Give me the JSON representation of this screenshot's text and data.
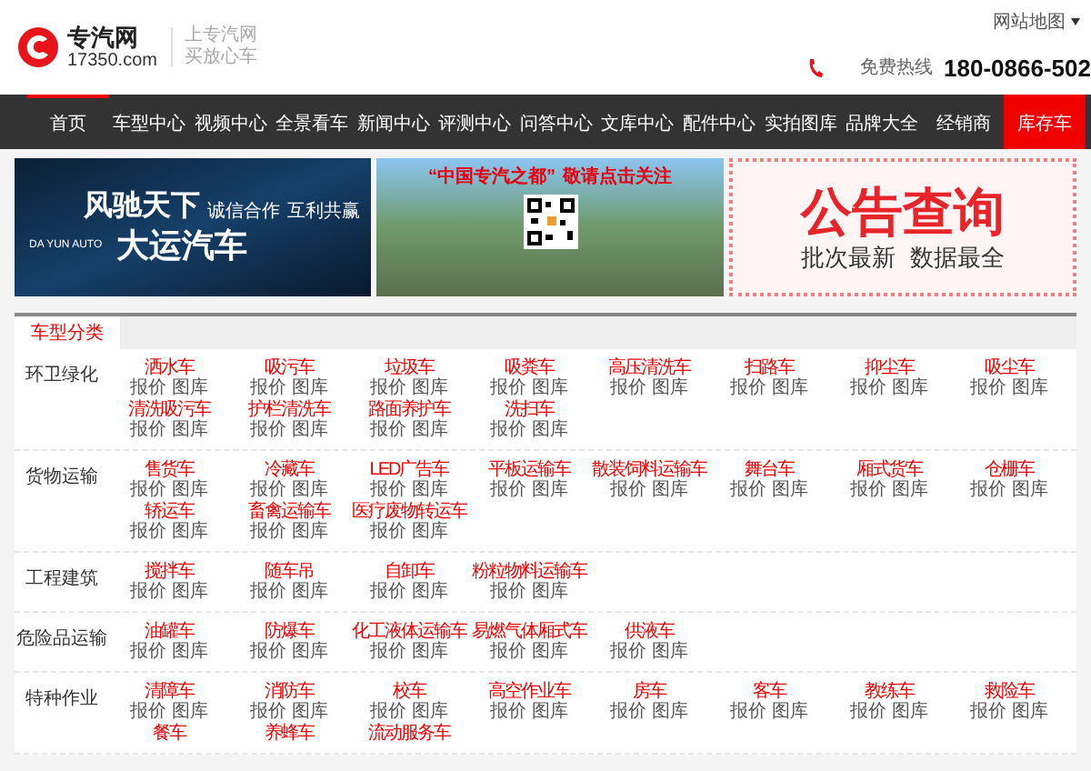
{
  "header": {
    "logo_name": "专汽网",
    "logo_domain": "17350.com",
    "slogan": [
      "上专汽网",
      "买放心车"
    ],
    "site_map": "网站地图",
    "hotline_label": "免费热线",
    "hotline": "180-0866-502"
  },
  "nav": [
    {
      "label": "首页",
      "selected": true,
      "kind": "normal"
    },
    {
      "label": "车型中心",
      "selected": false,
      "kind": "normal"
    },
    {
      "label": "视频中心",
      "selected": false,
      "kind": "normal"
    },
    {
      "label": "全景看车",
      "selected": false,
      "kind": "normal"
    },
    {
      "label": "新闻中心",
      "selected": false,
      "kind": "normal"
    },
    {
      "label": "评测中心",
      "selected": false,
      "kind": "normal"
    },
    {
      "label": "问答中心",
      "selected": false,
      "kind": "normal"
    },
    {
      "label": "文库中心",
      "selected": false,
      "kind": "normal"
    },
    {
      "label": "配件中心",
      "selected": false,
      "kind": "normal"
    },
    {
      "label": "实拍图库",
      "selected": false,
      "kind": "normal"
    },
    {
      "label": "品牌大全",
      "selected": false,
      "kind": "normal"
    },
    {
      "label": "经销商",
      "selected": false,
      "kind": "normal"
    },
    {
      "label": "库存车",
      "selected": false,
      "kind": "promo"
    }
  ],
  "banners": [
    {
      "kind": "brand",
      "title_top": "风驰天下",
      "taglines": [
        "诚信合作",
        "互利共赢"
      ],
      "brand_en": "DA YUN AUTO",
      "title_bottom": "大运汽车"
    },
    {
      "kind": "city",
      "headline": [
        "“中国专汽之都”",
        "敬请点击关注"
      ]
    },
    {
      "kind": "notice",
      "title": "公告查询",
      "subtitles": [
        "批次最新",
        "数据最全"
      ]
    }
  ],
  "tabs": [
    {
      "label": "车型分类",
      "selected": true
    }
  ],
  "categories": [
    {
      "name": "环卫绿化",
      "items": [
        {
          "name": "洒水车",
          "links": [
            "报价",
            "图库"
          ]
        },
        {
          "name": "吸污车",
          "links": [
            "报价",
            "图库"
          ]
        },
        {
          "name": "垃圾车",
          "links": [
            "报价",
            "图库"
          ]
        },
        {
          "name": "吸粪车",
          "links": [
            "报价",
            "图库"
          ]
        },
        {
          "name": "高压清洗车",
          "links": [
            "报价",
            "图库"
          ]
        },
        {
          "name": "扫路车",
          "links": [
            "报价",
            "图库"
          ]
        },
        {
          "name": "抑尘车",
          "links": [
            "报价",
            "图库"
          ]
        },
        {
          "name": "吸尘车",
          "links": [
            "报价",
            "图库"
          ]
        },
        {
          "name": "清洗吸污车",
          "links": [
            "报价",
            "图库"
          ]
        },
        {
          "name": "护栏清洗车",
          "links": [
            "报价",
            "图库"
          ]
        },
        {
          "name": "路面养护车",
          "links": [
            "报价",
            "图库"
          ]
        },
        {
          "name": "洗扫车",
          "links": [
            "报价",
            "图库"
          ]
        }
      ]
    },
    {
      "name": "货物运输",
      "items": [
        {
          "name": "售货车",
          "links": [
            "报价",
            "图库"
          ]
        },
        {
          "name": "冷藏车",
          "links": [
            "报价",
            "图库"
          ]
        },
        {
          "name": "LED广告车",
          "links": [
            "报价",
            "图库"
          ]
        },
        {
          "name": "平板运输车",
          "links": [
            "报价",
            "图库"
          ]
        },
        {
          "name": "散装饲料运输车",
          "links": [
            "报价",
            "图库"
          ]
        },
        {
          "name": "舞台车",
          "links": [
            "报价",
            "图库"
          ]
        },
        {
          "name": "厢式货车",
          "links": [
            "报价",
            "图库"
          ]
        },
        {
          "name": "仓栅车",
          "links": [
            "报价",
            "图库"
          ]
        },
        {
          "name": "轿运车",
          "links": [
            "报价",
            "图库"
          ]
        },
        {
          "name": "畜禽运输车",
          "links": [
            "报价",
            "图库"
          ]
        },
        {
          "name": "医疗废物转运车",
          "links": [
            "报价",
            "图库"
          ]
        }
      ]
    },
    {
      "name": "工程建筑",
      "items": [
        {
          "name": "搅拌车",
          "links": [
            "报价",
            "图库"
          ]
        },
        {
          "name": "随车吊",
          "links": [
            "报价",
            "图库"
          ]
        },
        {
          "name": "自卸车",
          "links": [
            "报价",
            "图库"
          ]
        },
        {
          "name": "粉粒物料运输车",
          "links": [
            "报价",
            "图库"
          ]
        }
      ]
    },
    {
      "name": "危险品运输",
      "items": [
        {
          "name": "油罐车",
          "links": [
            "报价",
            "图库"
          ]
        },
        {
          "name": "防爆车",
          "links": [
            "报价",
            "图库"
          ]
        },
        {
          "name": "化工液体运输车",
          "links": [
            "报价",
            "图库"
          ]
        },
        {
          "name": "易燃气体厢式车",
          "links": [
            "报价",
            "图库"
          ]
        },
        {
          "name": "供液车",
          "links": [
            "报价",
            "图库"
          ]
        }
      ]
    },
    {
      "name": "特种作业",
      "items": [
        {
          "name": "清障车",
          "links": [
            "报价",
            "图库"
          ]
        },
        {
          "name": "消防车",
          "links": [
            "报价",
            "图库"
          ]
        },
        {
          "name": "校车",
          "links": [
            "报价",
            "图库"
          ]
        },
        {
          "name": "高空作业车",
          "links": [
            "报价",
            "图库"
          ]
        },
        {
          "name": "房车",
          "links": [
            "报价",
            "图库"
          ]
        },
        {
          "name": "客车",
          "links": [
            "报价",
            "图库"
          ]
        },
        {
          "name": "教练车",
          "links": [
            "报价",
            "图库"
          ]
        },
        {
          "name": "救险车",
          "links": [
            "报价",
            "图库"
          ]
        },
        {
          "name": "餐车"
        },
        {
          "name": "养蜂车"
        },
        {
          "name": "流动服务车"
        }
      ]
    }
  ]
}
